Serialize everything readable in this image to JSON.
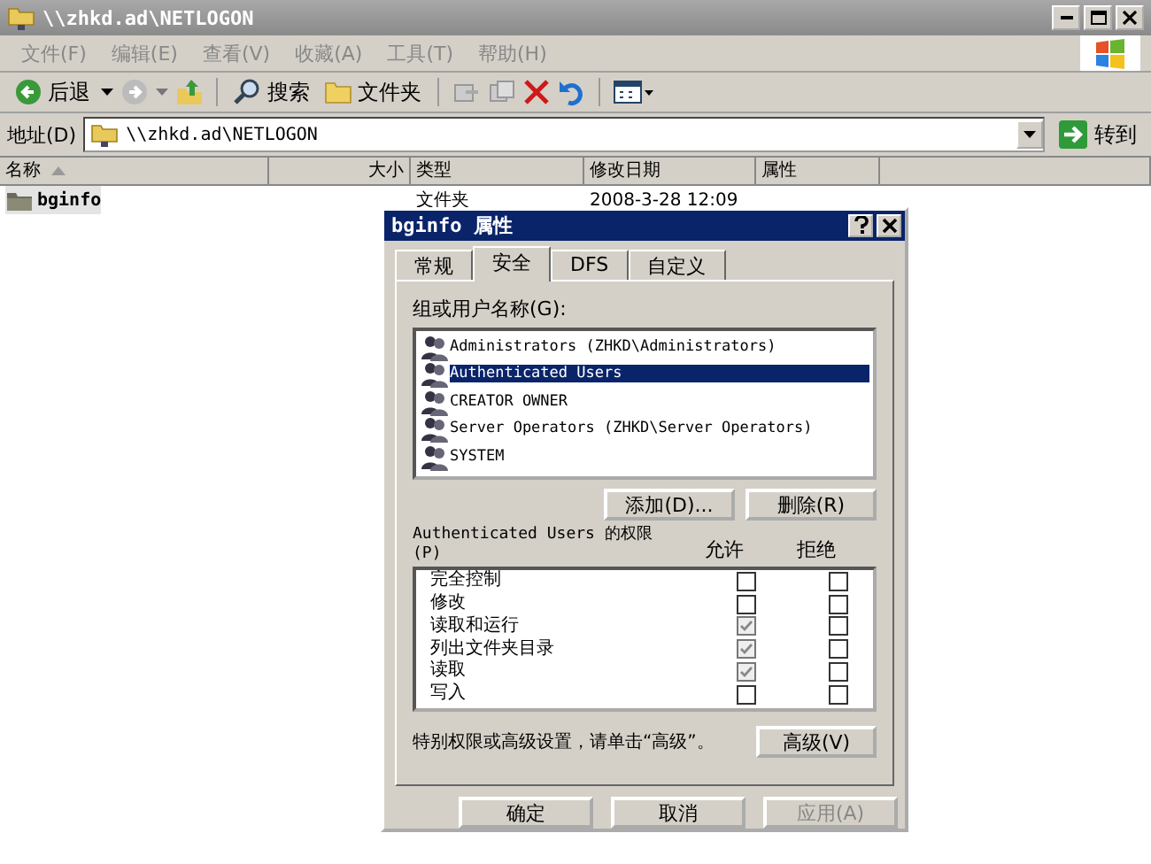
{
  "window": {
    "title": "\\\\zhkd.ad\\NETLOGON"
  },
  "menu": [
    "文件(F)",
    "编辑(E)",
    "查看(V)",
    "收藏(A)",
    "工具(T)",
    "帮助(H)"
  ],
  "toolbar": {
    "back": "后退",
    "search": "搜索",
    "folders": "文件夹"
  },
  "address": {
    "label": "地址(D)",
    "value": "\\\\zhkd.ad\\NETLOGON",
    "go": "转到"
  },
  "table": {
    "columns": [
      "名称",
      "大小",
      "类型",
      "修改日期",
      "属性"
    ],
    "rows": [
      {
        "name": "bginfo",
        "size": "",
        "type": "文件夹",
        "modified": "2008-3-28 12:09",
        "attributes": ""
      }
    ]
  },
  "dialog": {
    "title": "bginfo 属性",
    "tabs": [
      {
        "label": "常规",
        "selected": false
      },
      {
        "label": "安全",
        "selected": true
      },
      {
        "label": "DFS",
        "selected": false
      },
      {
        "label": "自定义",
        "selected": false
      }
    ],
    "users_label": "组或用户名称(G):",
    "users": [
      {
        "name": "Administrators (ZHKD\\Administrators)",
        "selected": false
      },
      {
        "name": "Authenticated Users",
        "selected": true
      },
      {
        "name": "CREATOR OWNER",
        "selected": false
      },
      {
        "name": "Server Operators (ZHKD\\Server Operators)",
        "selected": false
      },
      {
        "name": "SYSTEM",
        "selected": false
      }
    ],
    "add_button": "添加(D)...",
    "remove_button": "删除(R)",
    "permissions_label": "Authenticated Users 的权限 (P)",
    "allow_header": "允许",
    "deny_header": "拒绝",
    "permissions": [
      {
        "name": "完全控制",
        "allow": false,
        "deny": false
      },
      {
        "name": "修改",
        "allow": false,
        "deny": false
      },
      {
        "name": "读取和运行",
        "allow": true,
        "deny": false
      },
      {
        "name": "列出文件夹目录",
        "allow": true,
        "deny": false
      },
      {
        "name": "读取",
        "allow": true,
        "deny": false
      },
      {
        "name": "写入",
        "allow": false,
        "deny": false
      }
    ],
    "note": "特别权限或高级设置，请单击“高级”。",
    "advanced_button": "高级(V)",
    "buttons": [
      {
        "label": "确定",
        "disabled": false
      },
      {
        "label": "取消",
        "disabled": false
      },
      {
        "label": "应用(A)",
        "disabled": true
      }
    ]
  }
}
